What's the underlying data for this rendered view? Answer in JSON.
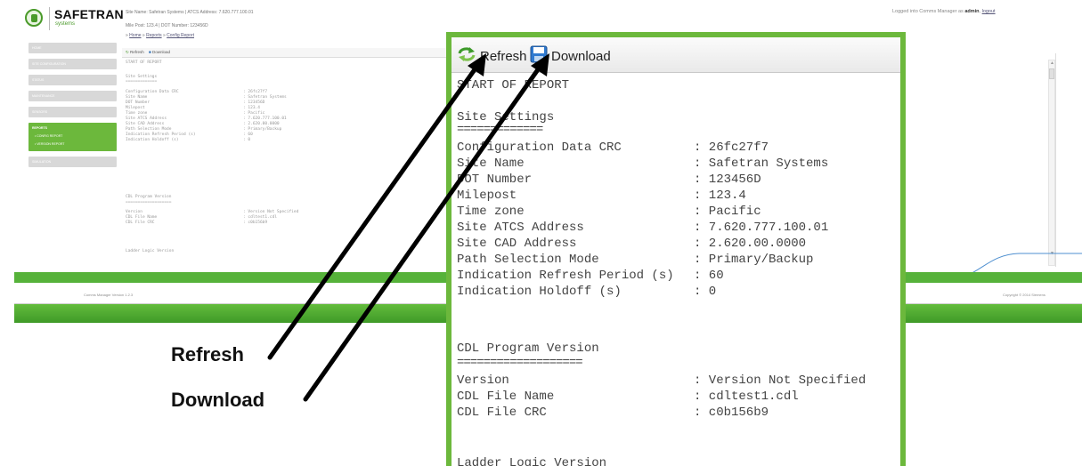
{
  "brand": {
    "name": "SAFETRAN",
    "subtitle": "systems"
  },
  "header": {
    "site_info": "Site Name: Safetran Systems | ATCS Address: 7.620.777.100.01",
    "site_info2": "Mile Post: 123.4 | DOT Number: 123456D",
    "breadcrumb": [
      "Home",
      "Reports",
      "Config Report"
    ],
    "breadcrumb_sep": "»",
    "login_prefix": "Logged into Comms Manager as",
    "login_user": "admin",
    "logout": "logout"
  },
  "sidebar": {
    "items": [
      "HOME",
      "SITE CONFIGURATION",
      "STATUS",
      "MAINTENANCE",
      "SENSORS"
    ],
    "active_group": "REPORTS",
    "active_subitems": [
      "• CONFIG REPORT",
      "• VERSION REPORT"
    ],
    "after_items": [
      "SIMULATION"
    ]
  },
  "toolbar": {
    "refresh_label": "Refresh",
    "download_label": "Download"
  },
  "report": {
    "start": "START OF REPORT",
    "site_settings_title": "Site Settings",
    "site_settings_underline": "=============",
    "site_settings": [
      {
        "label": "Configuration Data CRC",
        "value": ": 26fc27f7"
      },
      {
        "label": "Site Name",
        "value": ": Safetran Systems"
      },
      {
        "label": "DOT Number",
        "value": ": 123456D"
      },
      {
        "label": "Milepost",
        "value": ": 123.4"
      },
      {
        "label": "Time zone",
        "value": ": Pacific"
      },
      {
        "label": "Site ATCS Address",
        "value": ": 7.620.777.100.01"
      },
      {
        "label": "Site CAD Address",
        "value": ": 2.620.00.0000"
      },
      {
        "label": "Path Selection Mode",
        "value": ": Primary/Backup"
      },
      {
        "label": "Indication Refresh Period (s)",
        "value": ": 60"
      },
      {
        "label": "Indication Holdoff (s)",
        "value": ": 0"
      }
    ],
    "cdl_title": "CDL Program Version",
    "cdl_underline": "===================",
    "cdl": [
      {
        "label": "Version",
        "value": ": Version Not Specified"
      },
      {
        "label": "CDL File Name",
        "value": ": cdltest1.cdl"
      },
      {
        "label": "CDL File CRC",
        "value": ": c0b156b9"
      }
    ],
    "ladder_title": "Ladder Logic Version"
  },
  "footer": {
    "left": "Comms Manager Version 1.2.3",
    "right": "Copyright © 2014 Siemens"
  },
  "annotations": {
    "refresh": "Refresh",
    "download": "Download"
  },
  "colors": {
    "brand_green": "#6cb83c",
    "band_green": "#56b23a"
  }
}
